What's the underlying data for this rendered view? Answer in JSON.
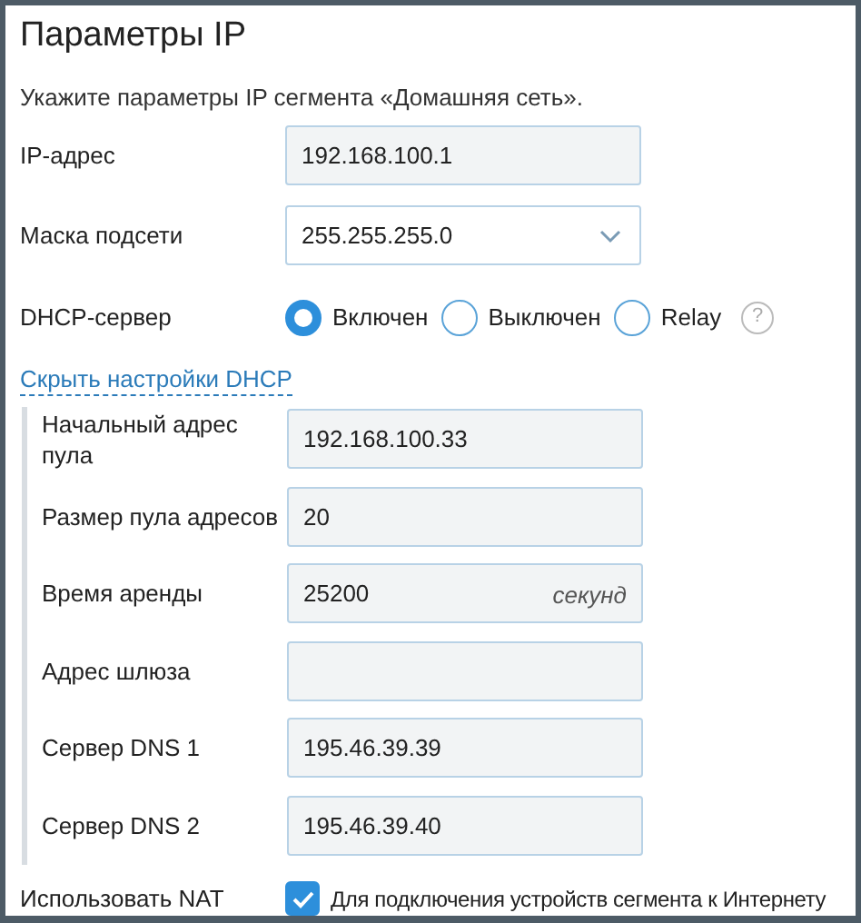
{
  "title": "Параметры IP",
  "description": "Укажите параметры IP сегмента «Домашняя сеть».",
  "fields": [
    {
      "kind": "input",
      "label": "IP-адрес",
      "value": "192.168.100.1"
    },
    {
      "kind": "select",
      "label": "Маска подсети",
      "value": "255.255.255.0"
    }
  ],
  "dhcp": {
    "label": "DHCP-сервер",
    "options": [
      {
        "label": "Включен",
        "selected": true
      },
      {
        "label": "Выключен",
        "selected": false
      },
      {
        "label": "Relay",
        "selected": false
      }
    ],
    "help": "?"
  },
  "toggle_link": "Скрыть настройки DHCP",
  "dhcp_fields": [
    {
      "label": "Начальный адрес пула",
      "value": "192.168.100.33"
    },
    {
      "label": "Размер пула адресов",
      "value": "20"
    },
    {
      "label": "Время аренды",
      "value": "25200",
      "unit": "секунд"
    },
    {
      "label": "Адрес шлюза"
    },
    {
      "label": "Сервер DNS 1",
      "value": "195.46.39.39"
    },
    {
      "label": "Сервер DNS 2",
      "value": "195.46.39.40"
    }
  ],
  "nat": {
    "label": "Использовать NAT",
    "checked": true,
    "text": "Для подключения устройств сегмента к Интернету"
  }
}
